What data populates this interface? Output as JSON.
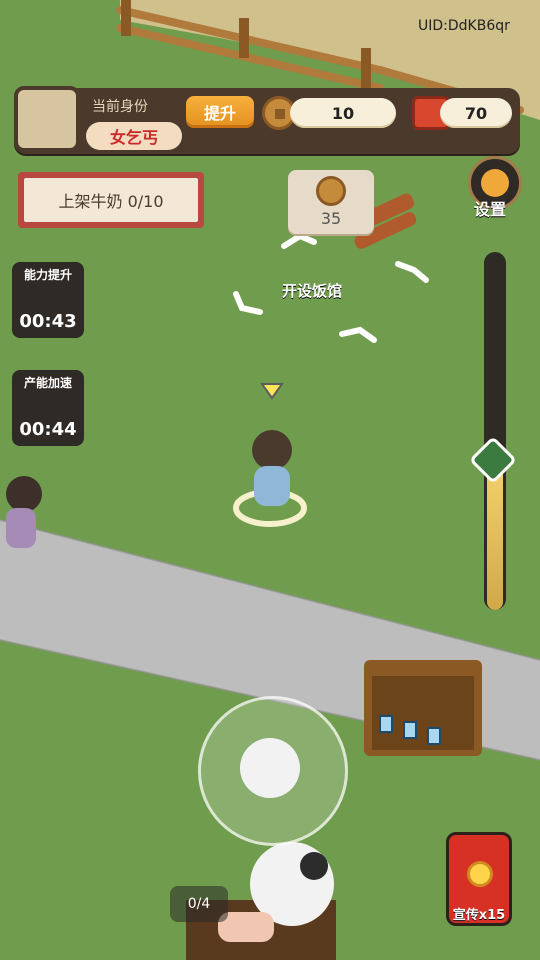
{
  "hud": {
    "identity_label": "当前身份",
    "identity_value": "女乞丐",
    "upgrade_label": "提升",
    "coin_amount": "10",
    "ticket_amount": "70",
    "uid": "UID:DdKB6qr"
  },
  "task": {
    "text": "上架牛奶 0/10"
  },
  "settings": {
    "label": "设置"
  },
  "timers": [
    {
      "title": "能力提升",
      "time": "00:43"
    },
    {
      "title": "产能加速",
      "time": "00:44"
    }
  ],
  "build": {
    "cost": "35",
    "label": "开设饭馆"
  },
  "counters": {
    "grass": "0/4"
  },
  "promo": {
    "label": "宣传x15"
  },
  "slider": {
    "level": 0.42
  }
}
